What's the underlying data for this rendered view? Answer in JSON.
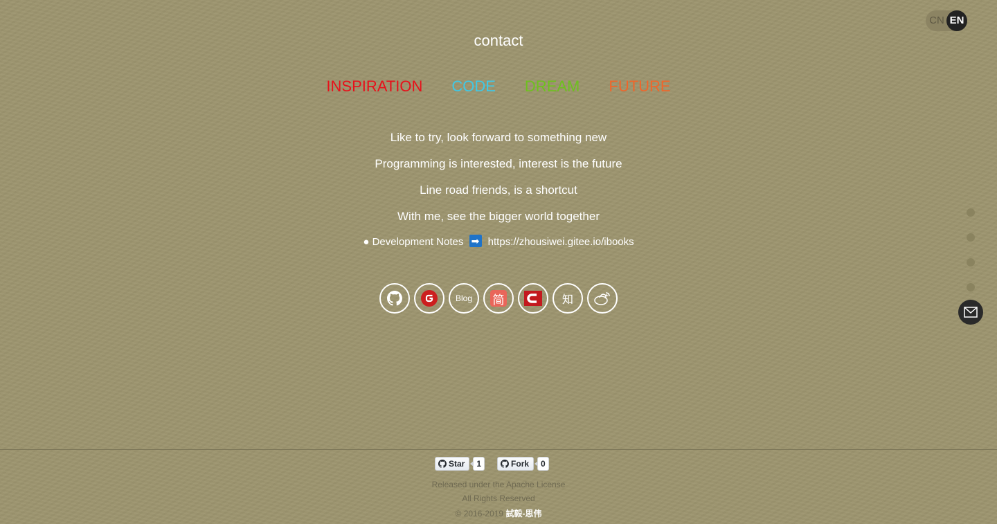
{
  "lang": {
    "cn": "CN",
    "en": "EN"
  },
  "page_title": "contact",
  "keywords": [
    {
      "label": "INSPIRATION",
      "color": "#e8101a"
    },
    {
      "label": "CODE",
      "color": "#3ec9e8"
    },
    {
      "label": "DREAM",
      "color": "#6ec11e"
    },
    {
      "label": "FUTURE",
      "color": "#f0662a"
    }
  ],
  "lines": [
    "Like to try, look forward to something new",
    "Programming is interested, interest is the future",
    "Line road friends, is a shortcut",
    "With me, see the bigger world together"
  ],
  "notes": {
    "bullet": "●",
    "label": "Development Notes",
    "arrow": "➡",
    "url": "https://zhousiwei.gitee.io/ibooks"
  },
  "socials": [
    {
      "name": "github",
      "icon": "github-icon"
    },
    {
      "name": "gitee",
      "icon": "gitee-icon"
    },
    {
      "name": "blog",
      "icon": "blog-icon",
      "text": "Blog"
    },
    {
      "name": "jianshu",
      "icon": "jianshu-icon",
      "text": "简"
    },
    {
      "name": "csdn",
      "icon": "csdn-icon"
    },
    {
      "name": "zhihu",
      "icon": "zhihu-icon",
      "text": "知"
    },
    {
      "name": "weibo",
      "icon": "weibo-icon"
    }
  ],
  "footer": {
    "star_label": "Star",
    "star_count": "1",
    "fork_label": "Fork",
    "fork_count": "0",
    "license": "Released under the Apache License",
    "rights": "All Rights Reserved",
    "copyright_prefix": "© 2016-2019",
    "author": "試毅-思伟"
  }
}
